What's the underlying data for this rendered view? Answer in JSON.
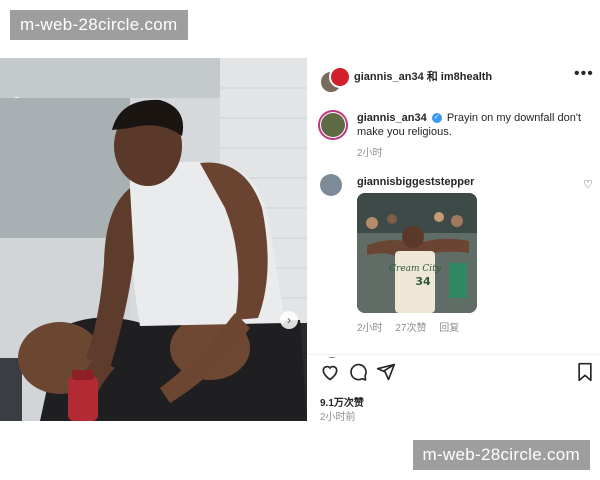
{
  "watermark": {
    "text": "m-web-28circle.com"
  },
  "post": {
    "header_title": "giannis_an34 和 im8health",
    "caption_user": "giannis_an34",
    "caption_text": "Prayin on my downfall don't make you religious.",
    "caption_time": "2小时",
    "likes": "9.1万次赞",
    "post_time": "2小时前"
  },
  "comment": {
    "user": "giannisbiggeststepper",
    "time": "2小时",
    "likes": "27次赞",
    "reply_label": "回复",
    "image_jersey_text": "Cream City",
    "image_jersey_number": "34"
  },
  "icons": {
    "more": "more-icon",
    "heart": "heart-icon",
    "comment": "comment-icon",
    "share": "share-icon",
    "save": "bookmark-icon",
    "verified": "verified-badge-icon",
    "next": "chevron-right-icon"
  },
  "colors": {
    "link_blue": "#3897f0",
    "story_ring": "#c13584",
    "watermark_bg": "#9e9e9e",
    "jersey_red": "#b22a33"
  }
}
